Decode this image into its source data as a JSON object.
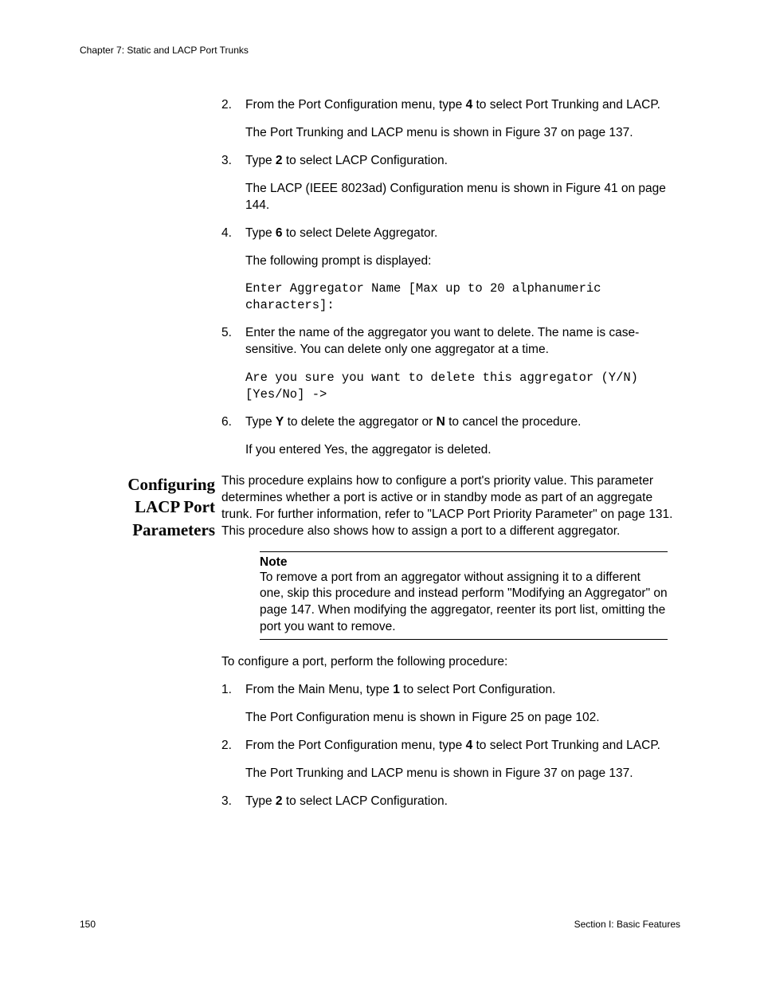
{
  "header": {
    "chapter": "Chapter 7: Static and LACP Port Trunks"
  },
  "top_list": {
    "item2": {
      "num": "2.",
      "p1a": "From the Port Configuration menu, type ",
      "p1b": "4",
      "p1c": " to select Port Trunking and LACP.",
      "p2": "The Port Trunking and LACP menu is shown in Figure 37 on page 137."
    },
    "item3": {
      "num": "3.",
      "p1a": "Type ",
      "p1b": "2",
      "p1c": " to select LACP Configuration.",
      "p2": "The LACP (IEEE 8023ad) Configuration menu is shown in Figure 41 on page 144."
    },
    "item4": {
      "num": "4.",
      "p1a": "Type ",
      "p1b": "6",
      "p1c": " to select Delete Aggregator.",
      "p2": "The following prompt is displayed:",
      "mono": "Enter Aggregator Name [Max up to 20 alphanumeric characters]:"
    },
    "item5": {
      "num": "5.",
      "p1": "Enter the name of the aggregator you want to delete. The name is case-sensitive. You can delete only one aggregator at a time.",
      "mono": "Are you sure you want to delete this aggregator (Y/N) [Yes/No] ->"
    },
    "item6": {
      "num": "6.",
      "p1a": "Type ",
      "p1b": "Y",
      "p1c": " to delete the aggregator or ",
      "p1d": "N",
      "p1e": " to cancel the procedure.",
      "p2": "If you entered Yes, the aggregator is deleted."
    }
  },
  "section2": {
    "heading_l1": "Configuring",
    "heading_l2": "LACP Port",
    "heading_l3": "Parameters",
    "intro": "This procedure explains how to configure a port's priority value. This parameter determines whether a port is active or in standby mode as part of an aggregate trunk. For further information, refer to \"LACP Port Priority Parameter\" on page 131. This procedure also shows how to assign a port to a different aggregator.",
    "note": {
      "label": "Note",
      "text": "To remove a port from an aggregator without assigning it to a different one, skip this procedure and instead perform \"Modifying an Aggregator\" on page 147. When modifying the aggregator, reenter its port list, omitting the port you want to remove."
    },
    "lead": "To configure a port, perform the following procedure:",
    "item1": {
      "num": "1.",
      "p1a": "From the Main Menu, type ",
      "p1b": "1",
      "p1c": " to select Port Configuration.",
      "p2": "The Port Configuration menu is shown in Figure 25 on page 102."
    },
    "item2": {
      "num": "2.",
      "p1a": "From the Port Configuration menu, type ",
      "p1b": "4",
      "p1c": " to select Port Trunking and LACP.",
      "p2": "The Port Trunking and LACP menu is shown in Figure 37 on page 137."
    },
    "item3": {
      "num": "3.",
      "p1a": "Type ",
      "p1b": "2",
      "p1c": " to select LACP Configuration."
    }
  },
  "footer": {
    "page": "150",
    "section": "Section I: Basic Features"
  }
}
